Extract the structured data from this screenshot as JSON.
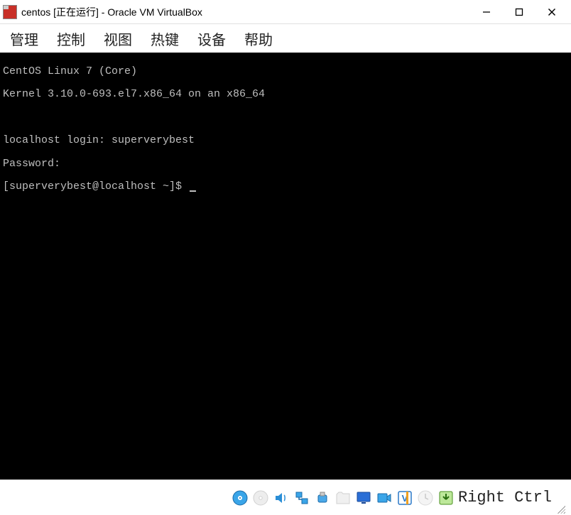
{
  "titlebar": {
    "title": "centos [正在运行] - Oracle VM VirtualBox"
  },
  "menubar": {
    "items": [
      "管理",
      "控制",
      "视图",
      "热键",
      "设备",
      "帮助"
    ]
  },
  "terminal": {
    "lines": [
      "CentOS Linux 7 (Core)",
      "Kernel 3.10.0-693.el7.x86_64 on an x86_64",
      "",
      "localhost login: superverybest",
      "Password:",
      "[superverybest@localhost ~]$ "
    ]
  },
  "statusbar": {
    "host_key": "Right Ctrl",
    "icons": [
      "hard-disk-icon",
      "optical-disc-icon",
      "audio-icon",
      "network-icon",
      "usb-icon",
      "shared-folder-icon",
      "display-icon",
      "recording-icon",
      "guest-additions-icon",
      "mouse-integration-icon",
      "keyboard-capture-icon"
    ]
  }
}
